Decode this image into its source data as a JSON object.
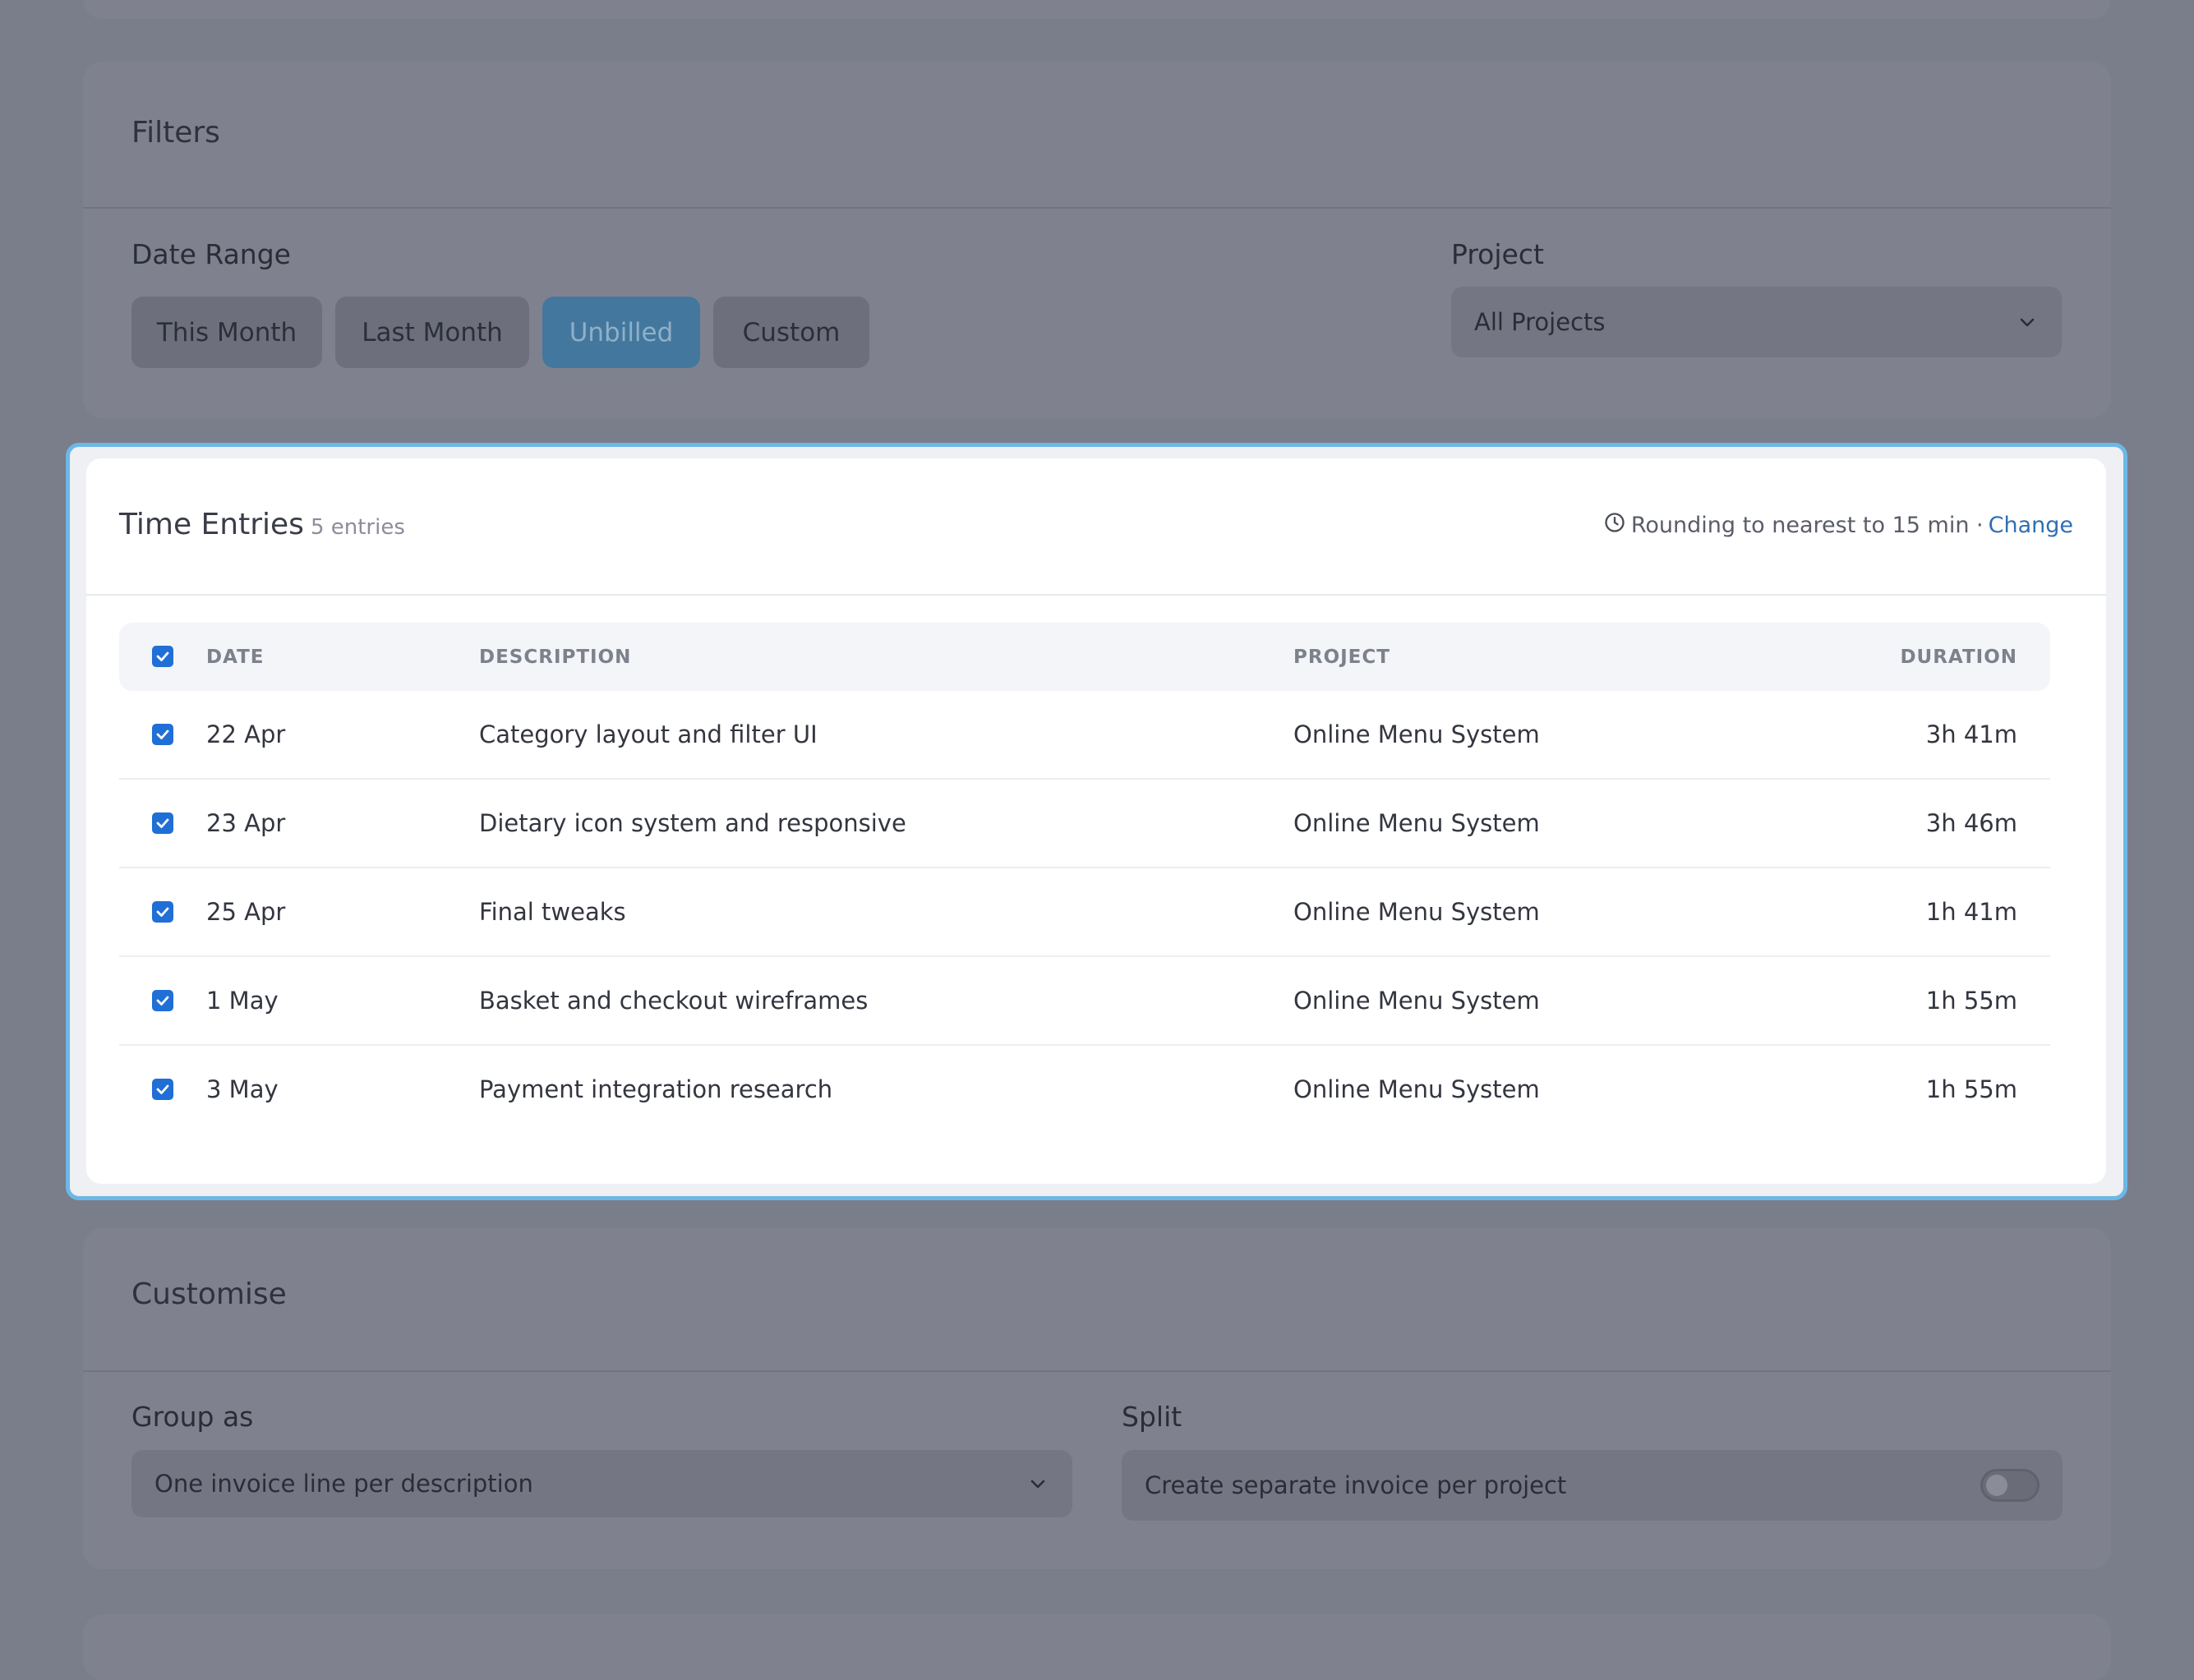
{
  "filters": {
    "title": "Filters",
    "date_range_label": "Date Range",
    "date_range_options": [
      "This Month",
      "Last Month",
      "Unbilled",
      "Custom"
    ],
    "date_range_selected": "Unbilled",
    "project_label": "Project",
    "project_value": "All Projects"
  },
  "time_entries": {
    "title": "Time Entries",
    "count": "5 entries",
    "rounding_text": "Rounding to nearest to 15 min ·",
    "change_link": "Change",
    "columns": {
      "date": "DATE",
      "description": "DESCRIPTION",
      "project": "PROJECT",
      "duration": "DURATION"
    },
    "rows": [
      {
        "date": "22 Apr",
        "description": "Category layout and filter UI",
        "project": "Online Menu System",
        "duration": "3h 41m",
        "checked": true
      },
      {
        "date": "23 Apr",
        "description": "Dietary icon system and responsive",
        "project": "Online Menu System",
        "duration": "3h 46m",
        "checked": true
      },
      {
        "date": "25 Apr",
        "description": "Final tweaks",
        "project": "Online Menu System",
        "duration": "1h 41m",
        "checked": true
      },
      {
        "date": "1 May",
        "description": "Basket and checkout wireframes",
        "project": "Online Menu System",
        "duration": "1h 55m",
        "checked": true
      },
      {
        "date": "3 May",
        "description": "Payment integration research",
        "project": "Online Menu System",
        "duration": "1h 55m",
        "checked": true
      }
    ]
  },
  "customise": {
    "title": "Customise",
    "group_label": "Group as",
    "group_value": "One invoice line per description",
    "split_label": "Split",
    "split_value": "Create separate invoice per project",
    "split_enabled": false
  },
  "colors": {
    "accent": "#1f6fd6",
    "focus_border": "#6bb8e6",
    "link": "#2f6fb3",
    "overlay": "#7a7d8a"
  }
}
